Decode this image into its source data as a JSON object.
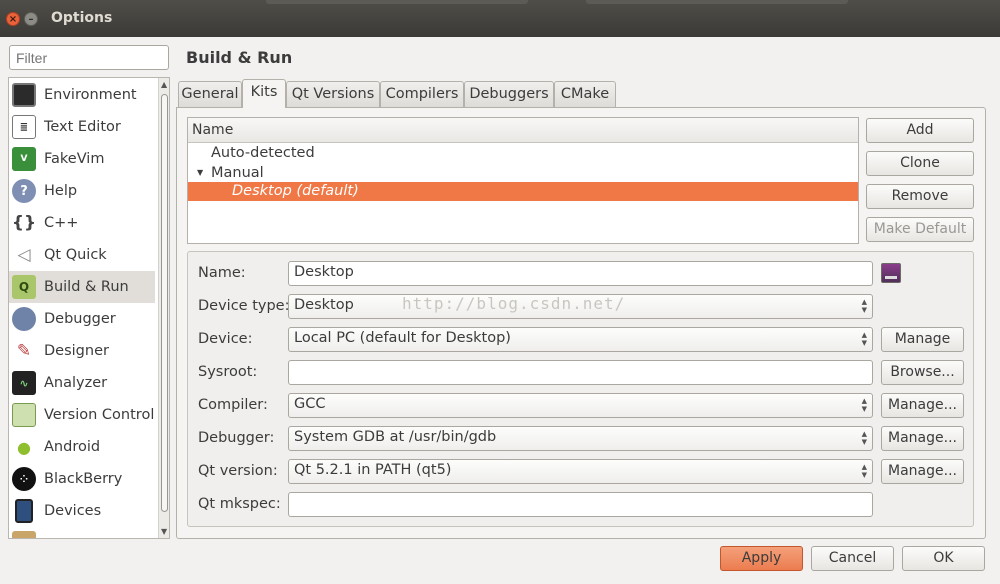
{
  "window": {
    "title": "Options",
    "close_glyph": "×",
    "minimize_glyph": "–"
  },
  "filter": {
    "placeholder": "Filter"
  },
  "categories": [
    {
      "label": "Environment",
      "icon": "monitor-icon"
    },
    {
      "label": "Text Editor",
      "icon": "text-editor-icon"
    },
    {
      "label": "FakeVim",
      "icon": "fakevim-icon"
    },
    {
      "label": "Help",
      "icon": "help-icon"
    },
    {
      "label": "C++",
      "icon": "cpp-braces-icon"
    },
    {
      "label": "Qt Quick",
      "icon": "qt-quick-icon"
    },
    {
      "label": "Build & Run",
      "icon": "build-run-icon",
      "selected": true
    },
    {
      "label": "Debugger",
      "icon": "debugger-bug-icon"
    },
    {
      "label": "Designer",
      "icon": "designer-tools-icon"
    },
    {
      "label": "Analyzer",
      "icon": "analyzer-icon"
    },
    {
      "label": "Version Control",
      "icon": "version-control-icon"
    },
    {
      "label": "Android",
      "icon": "android-icon"
    },
    {
      "label": "BlackBerry",
      "icon": "blackberry-icon"
    },
    {
      "label": "Devices",
      "icon": "devices-icon"
    }
  ],
  "page_title": "Build & Run",
  "tabs": [
    {
      "label": "General"
    },
    {
      "label": "Kits",
      "active": true
    },
    {
      "label": "Qt Versions"
    },
    {
      "label": "Compilers"
    },
    {
      "label": "Debuggers"
    },
    {
      "label": "CMake"
    }
  ],
  "kits": {
    "header": "Name",
    "rows": [
      {
        "label": "Auto-detected"
      },
      {
        "label": "Manual",
        "expander": "▼"
      },
      {
        "label": "Desktop (default)",
        "selected": true
      }
    ]
  },
  "kit_buttons": {
    "add": "Add",
    "clone": "Clone",
    "remove": "Remove",
    "make_default": "Make Default"
  },
  "properties": {
    "name_label": "Name:",
    "name_value": "Desktop",
    "device_type_label": "Device type:",
    "device_type_value": "Desktop",
    "device_label": "Device:",
    "device_value": "Local PC (default for Desktop)",
    "sysroot_label": "Sysroot:",
    "sysroot_value": "",
    "compiler_label": "Compiler:",
    "compiler_value": "GCC",
    "debugger_label": "Debugger:",
    "debugger_value": "System GDB at /usr/bin/gdb",
    "qt_version_label": "Qt version:",
    "qt_version_value": "Qt 5.2.1 in PATH (qt5)",
    "qt_mkspec_label": "Qt mkspec:",
    "qt_mkspec_value": ""
  },
  "property_buttons": {
    "manage": "Manage",
    "browse": "Browse...",
    "compiler_manage": "Manage...",
    "debugger_manage": "Manage...",
    "qt_version_manage": "Manage..."
  },
  "watermark": "http://blog.csdn.net/",
  "footer": {
    "apply": "Apply",
    "cancel": "Cancel",
    "ok": "OK"
  },
  "colors": {
    "selection": "#f07746",
    "title_bar": "#3c3b37",
    "close_button": "#e8623b"
  }
}
